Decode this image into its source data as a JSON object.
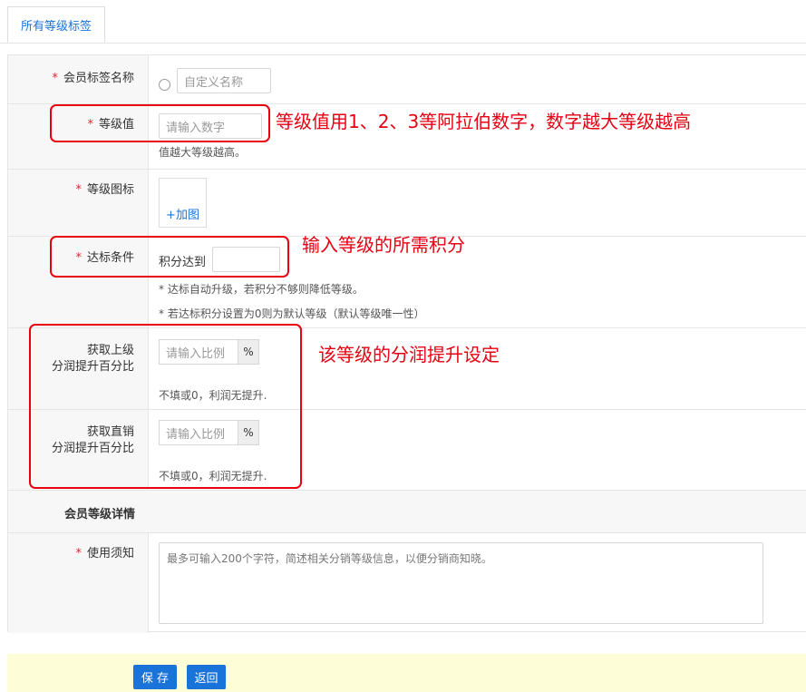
{
  "tabs": [
    {
      "label": "所有等级标签",
      "active": true
    }
  ],
  "form": {
    "name_row": {
      "label": "会员标签名称",
      "input_placeholder": "自定义名称"
    },
    "level_value_row": {
      "label": "等级值",
      "input_placeholder": "请输入数字",
      "hint": "值越大等级越高。"
    },
    "level_icon_row": {
      "label": "等级图标",
      "upload_label": "+加图"
    },
    "condition_row": {
      "label": "达标条件",
      "prefix": "积分达到",
      "note1": "* 达标自动升级，若积分不够则降低等级。",
      "note2": "* 若达标积分设置为0则为默认等级（默认等级唯一性）"
    },
    "upper_share_row": {
      "label_line1": "获取上级",
      "label_line2": "分润提升百分比",
      "input_placeholder": "请输入比例",
      "addon": "%",
      "hint": "不填或0，利润无提升."
    },
    "direct_share_row": {
      "label_line1": "获取直销",
      "label_line2": "分润提升百分比",
      "input_placeholder": "请输入比例",
      "addon": "%",
      "hint": "不填或0，利润无提升."
    },
    "detail_section": {
      "label": "会员等级详情"
    },
    "notice_row": {
      "label": "使用须知",
      "textarea_placeholder": "最多可输入200个字符，简述相关分销等级信息，以便分销商知晓。"
    },
    "required_mark": "*"
  },
  "footer": {
    "save_label": "保 存",
    "back_label": "返回"
  },
  "annotations": {
    "level_value": "等级值用1、2、3等阿拉伯数字，数字越大等级越高",
    "condition": "输入等级的所需积分",
    "share": "该等级的分润提升设定"
  },
  "colors": {
    "accent": "#1a73d9",
    "required": "#e0262c",
    "annotation": "#e60012",
    "footer_bg": "#fdfdd8",
    "label_bg": "#f7f7f7"
  }
}
